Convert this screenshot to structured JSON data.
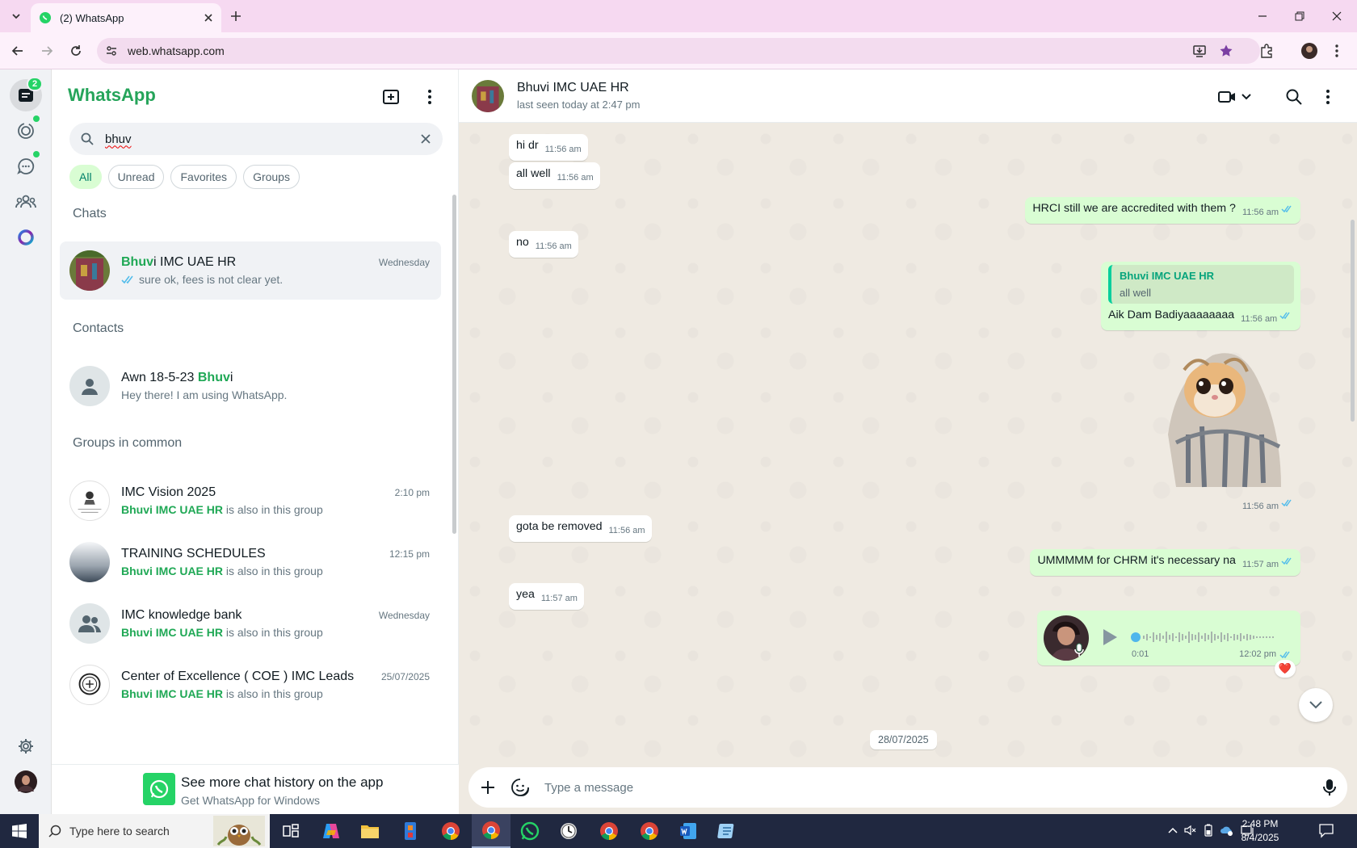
{
  "browser": {
    "tab_title": "(2) WhatsApp",
    "url": "web.whatsapp.com"
  },
  "rail": {
    "unread_badge": "2"
  },
  "sidebar": {
    "brand": "WhatsApp",
    "search_value": "bhuv",
    "filters": [
      "All",
      "Unread",
      "Favorites",
      "Groups"
    ],
    "active_filter": "All",
    "section_chats": "Chats",
    "section_contacts": "Contacts",
    "section_groups": "Groups in common",
    "chat": {
      "name_highlight": "Bhuv",
      "name_rest": "i IMC UAE HR",
      "time": "Wednesday",
      "preview": "sure ok, fees is not clear yet."
    },
    "contact": {
      "name_prefix": "Awn 18-5-23 ",
      "name_highlight": "Bhuv",
      "name_suffix": "i",
      "about": "Hey there! I am using WhatsApp."
    },
    "groups": [
      {
        "name": "IMC Vision 2025",
        "time": "2:10 pm",
        "member": "Bhuvi IMC UAE HR",
        "note": " is also in this group"
      },
      {
        "name": "TRAINING SCHEDULES",
        "time": "12:15 pm",
        "member": "Bhuvi IMC UAE HR",
        "note": " is also in this group"
      },
      {
        "name": "IMC knowledge bank",
        "time": "Wednesday",
        "member": "Bhuvi IMC UAE HR",
        "note": " is also in this group"
      },
      {
        "name": "Center of Excellence ( COE ) IMC Leads",
        "time": "25/07/2025",
        "member": "Bhuvi IMC UAE HR",
        "note": " is also in this group"
      }
    ],
    "promo_title": "See more chat history on the app",
    "promo_sub": "Get WhatsApp for Windows"
  },
  "chat": {
    "name": "Bhuvi IMC UAE HR",
    "status": "last seen today at 2:47 pm",
    "messages": [
      {
        "dir": "in",
        "text": "hi dr",
        "time": "11:56 am"
      },
      {
        "dir": "in",
        "text": "all well",
        "time": "11:56 am"
      },
      {
        "dir": "out",
        "text": "HRCI still we are accredited with them ?",
        "time": "11:56 am"
      },
      {
        "dir": "in",
        "text": "no",
        "time": "11:56 am"
      },
      {
        "dir": "out",
        "quote_name": "Bhuvi IMC UAE HR",
        "quote_text": "all well",
        "text": "Aik Dam Badiyaaaaaaaa",
        "time": "11:56 am"
      },
      {
        "dir": "out",
        "type": "sticker",
        "time": "11:56 am"
      },
      {
        "dir": "in",
        "text": "gota be removed",
        "time": "11:56 am"
      },
      {
        "dir": "out",
        "text": "UMMMMM for CHRM it's necessary na",
        "time": "11:57 am"
      },
      {
        "dir": "in",
        "text": "yea",
        "time": "11:57 am"
      },
      {
        "dir": "out",
        "type": "voice",
        "duration": "0:01",
        "time": "12:02 pm",
        "reaction": "❤️"
      }
    ],
    "date_divider": "28/07/2025",
    "composer_placeholder": "Type a message"
  },
  "taskbar": {
    "search_placeholder": "Type here to search",
    "time": "2:48 PM",
    "date": "8/4/2025"
  },
  "colors": {
    "accent": "#25d366",
    "brand_text": "#25a45a",
    "outgoing_bubble": "#d9fdd3",
    "incoming_bubble": "#ffffff",
    "chat_bg": "#efeae2",
    "read_tick": "#53bdeb"
  }
}
